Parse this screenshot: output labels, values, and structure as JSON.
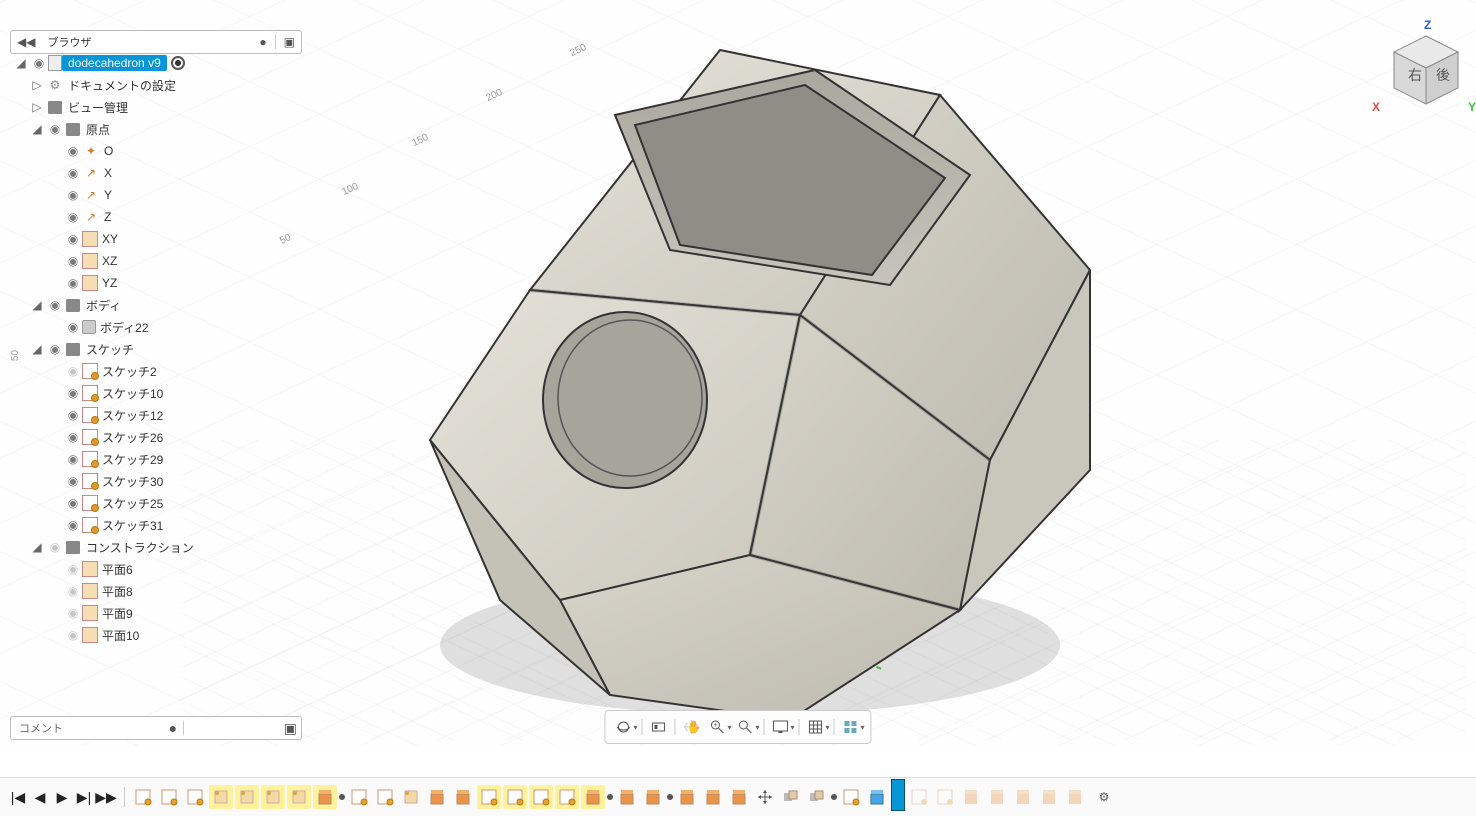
{
  "browser": {
    "title": "ブラウザ",
    "root": {
      "label": "dodecahedron v9"
    },
    "doc_settings": "ドキュメントの設定",
    "view_mgmt": "ビュー管理",
    "origin_group": "原点",
    "origin_items": [
      {
        "label": "O",
        "icon": "origin"
      },
      {
        "label": "X",
        "icon": "axis"
      },
      {
        "label": "Y",
        "icon": "axis"
      },
      {
        "label": "Z",
        "icon": "axis"
      },
      {
        "label": "XY",
        "icon": "plane"
      },
      {
        "label": "XZ",
        "icon": "plane"
      },
      {
        "label": "YZ",
        "icon": "plane"
      }
    ],
    "bodies_group": "ボディ",
    "bodies": [
      {
        "label": "ボディ22"
      }
    ],
    "sketch_group": "スケッチ",
    "sketches": [
      {
        "label": "スケッチ2",
        "hidden": true
      },
      {
        "label": "スケッチ10",
        "hidden": false
      },
      {
        "label": "スケッチ12",
        "hidden": false
      },
      {
        "label": "スケッチ26",
        "hidden": false
      },
      {
        "label": "スケッチ29",
        "hidden": false
      },
      {
        "label": "スケッチ30",
        "hidden": false
      },
      {
        "label": "スケッチ25",
        "hidden": false
      },
      {
        "label": "スケッチ31",
        "hidden": false
      }
    ],
    "construction_group": "コンストラクション",
    "constructions": [
      {
        "label": "平面6"
      },
      {
        "label": "平面8"
      },
      {
        "label": "平面9"
      },
      {
        "label": "平面10"
      }
    ]
  },
  "comment": {
    "label": "コメント"
  },
  "viewcube": {
    "face_right": "右",
    "face_back": "後",
    "axis_x": "X",
    "axis_y": "Y",
    "axis_z": "Z"
  },
  "ruler_ticks": [
    "50",
    "100",
    "150",
    "200",
    "250"
  ],
  "navtools": {
    "orbit": "orbit",
    "lookat": "lookat",
    "pan": "pan",
    "zoom": "zoom",
    "zoomwin": "zoom-window",
    "display": "display",
    "grid": "grid",
    "layout": "layout"
  },
  "timeline": {
    "nodes": [
      {
        "t": "sketch",
        "hl": false
      },
      {
        "t": "sketch",
        "hl": false
      },
      {
        "t": "sketch",
        "hl": false
      },
      {
        "t": "plane",
        "hl": true
      },
      {
        "t": "plane",
        "hl": true
      },
      {
        "t": "plane",
        "hl": true
      },
      {
        "t": "plane",
        "hl": true
      },
      {
        "t": "extrude",
        "hl": true
      },
      {
        "t": "dot",
        "hl": false
      },
      {
        "t": "sketch",
        "hl": false
      },
      {
        "t": "sketch",
        "hl": false
      },
      {
        "t": "plane",
        "hl": false
      },
      {
        "t": "extrude",
        "hl": false
      },
      {
        "t": "extrude",
        "hl": false
      },
      {
        "t": "sketch",
        "hl": true
      },
      {
        "t": "sketch",
        "hl": true
      },
      {
        "t": "sketch",
        "hl": true
      },
      {
        "t": "sketch",
        "hl": true
      },
      {
        "t": "extrude",
        "hl": true
      },
      {
        "t": "dot",
        "hl": false
      },
      {
        "t": "extrude",
        "hl": false
      },
      {
        "t": "extrude",
        "hl": false
      },
      {
        "t": "dot",
        "hl": false
      },
      {
        "t": "extrude",
        "hl": false
      },
      {
        "t": "extrude",
        "hl": false
      },
      {
        "t": "extrude",
        "hl": false
      },
      {
        "t": "move",
        "hl": false
      },
      {
        "t": "combine",
        "hl": false
      },
      {
        "t": "combine",
        "hl": false
      },
      {
        "t": "dot",
        "hl": false
      },
      {
        "t": "sketch",
        "hl": false
      },
      {
        "t": "extrude-blue",
        "hl": false
      },
      {
        "t": "marker",
        "hl": false
      },
      {
        "t": "sketch-d",
        "hl": false
      },
      {
        "t": "sketch-d",
        "hl": false
      },
      {
        "t": "extrude-d",
        "hl": false
      },
      {
        "t": "extrude-d",
        "hl": false
      },
      {
        "t": "extrude-d",
        "hl": false
      },
      {
        "t": "extrude-d",
        "hl": false
      },
      {
        "t": "extrude-d",
        "hl": false
      }
    ]
  }
}
